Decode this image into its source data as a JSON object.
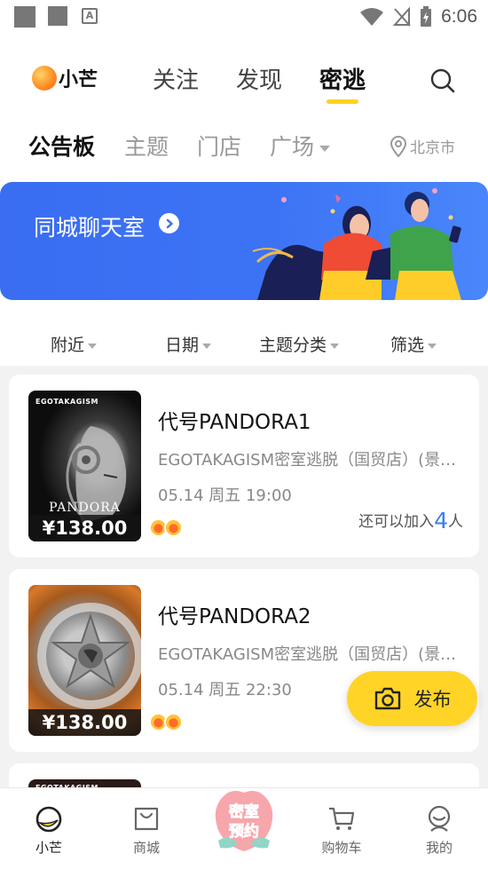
{
  "status_bar": {
    "time": "6:06"
  },
  "app": {
    "logo_text": "小芒"
  },
  "top_tabs": [
    {
      "label": "关注"
    },
    {
      "label": "发现"
    },
    {
      "label": "密逃",
      "active": true
    }
  ],
  "sub_tabs": [
    {
      "label": "公告板",
      "active": true
    },
    {
      "label": "主题"
    },
    {
      "label": "门店"
    },
    {
      "label": "广场"
    }
  ],
  "location": {
    "city": "北京市"
  },
  "banner": {
    "title": "同城聊天室"
  },
  "filters": [
    {
      "label": "附近"
    },
    {
      "label": "日期"
    },
    {
      "label": "主题分类"
    },
    {
      "label": "筛选"
    }
  ],
  "cards": [
    {
      "poster_brand": "EGOTAKAGISM",
      "poster_name": "PANDORA",
      "price": "¥138.00",
      "title": "代号PANDORA1",
      "venue": "EGOTAKAGISM密室逃脱（国贸店）(景…",
      "time": "05.14 周五 19:00",
      "join_prefix": "还可以加入",
      "join_count": "4",
      "join_suffix": "人"
    },
    {
      "poster_brand": "",
      "poster_name": "",
      "price": "¥138.00",
      "title": "代号PANDORA2",
      "venue": "EGOTAKAGISM密室逃脱（国贸店）(景…",
      "time": "05.14 周五 22:30",
      "join_prefix": "",
      "join_count": "",
      "join_suffix": ""
    },
    {
      "poster_brand": "EGOTAKAGISM"
    }
  ],
  "publish": {
    "label": "发布"
  },
  "bottom_tabs": [
    {
      "label": "小芒",
      "icon": "mango-icon",
      "active": true
    },
    {
      "label": "商城",
      "icon": "shop-bag-icon"
    },
    {
      "label": "密室预约",
      "icon": "escape-room-badge-icon"
    },
    {
      "label": "购物车",
      "icon": "cart-icon"
    },
    {
      "label": "我的",
      "icon": "profile-icon"
    }
  ],
  "colors": {
    "accent": "#ffd21f",
    "banner": "#3a6df2",
    "count": "#3a7df2"
  }
}
